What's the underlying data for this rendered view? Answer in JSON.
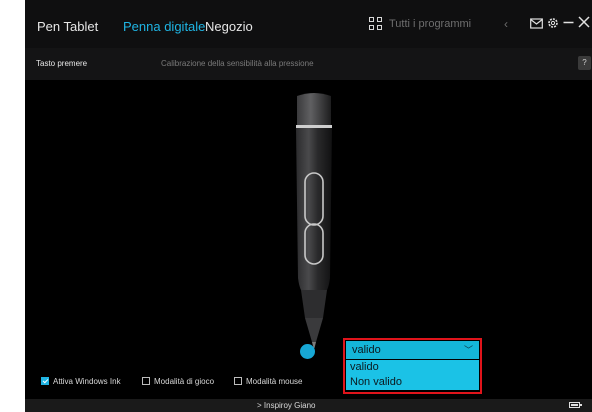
{
  "nav": {
    "tabs": [
      {
        "label": "Pen Tablet",
        "active": false
      },
      {
        "label": "Penna digitale",
        "active": true
      },
      {
        "label": "Negozio",
        "active": false
      }
    ],
    "programs_placeholder": "Tutti i programmi",
    "icons": [
      "grid-icon",
      "chevron-left-icon",
      "mail-icon",
      "gear-icon",
      "minimize-icon",
      "close-icon"
    ]
  },
  "subheader": {
    "left_label": "Tasto premere",
    "center_label": "Calibrazione della sensibilità alla pressione",
    "help": "?"
  },
  "pen_tip_dropdown": {
    "selected": "valido",
    "options": [
      "valido",
      "Non valido"
    ]
  },
  "options": [
    {
      "label": "Attiva Windows Ink",
      "checked": true
    },
    {
      "label": "Modalità di gioco",
      "checked": false
    },
    {
      "label": "Modalità mouse",
      "checked": false
    }
  ],
  "footer": {
    "device": "Inspiroy Giano",
    "device_prefix": ">"
  },
  "colors": {
    "accent": "#1fb4e3",
    "dropdown": "#14b6d9",
    "highlight_outline": "#e0141b",
    "background": "#000000"
  }
}
